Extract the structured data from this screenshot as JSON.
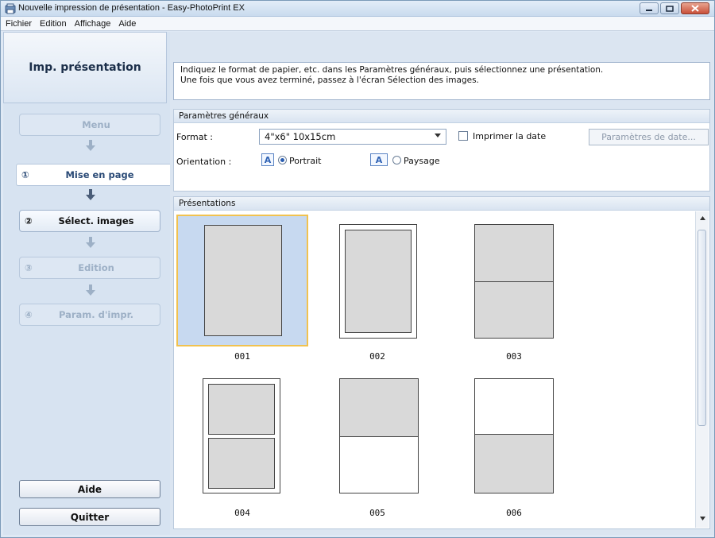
{
  "window": {
    "title": "Nouvelle impression de présentation - Easy-PhotoPrint EX"
  },
  "menu": [
    "Fichier",
    "Edition",
    "Affichage",
    "Aide"
  ],
  "nav": {
    "header": "Imp. présentation",
    "steps": [
      {
        "num": "",
        "label": "Menu"
      },
      {
        "num": "①",
        "label": "Mise en page"
      },
      {
        "num": "②",
        "label": "Sélect. images"
      },
      {
        "num": "③",
        "label": "Edition"
      },
      {
        "num": "④",
        "label": "Param. d'impr."
      }
    ],
    "help": "Aide",
    "quit": "Quitter"
  },
  "instructions": {
    "line1": "Indiquez le format de papier, etc. dans les Paramètres généraux, puis sélectionnez une présentation.",
    "line2": "Une fois que vous avez terminé, passez à l'écran Sélection des images."
  },
  "general": {
    "title": "Paramètres généraux",
    "format_label": "Format :",
    "format_value": "4\"x6\" 10x15cm",
    "print_date_label": "Imprimer la date",
    "date_settings_button": "Paramètres de date...",
    "orientation_label": "Orientation :",
    "portrait": "Portrait",
    "landscape": "Paysage",
    "orientation_selected": "Portrait"
  },
  "layouts": {
    "title": "Présentations",
    "selected": "001",
    "items": [
      "001",
      "002",
      "003",
      "004",
      "005",
      "006"
    ]
  },
  "colors": {
    "selection_border": "#f1c24f",
    "selection_fill": "#c7d9f0"
  }
}
